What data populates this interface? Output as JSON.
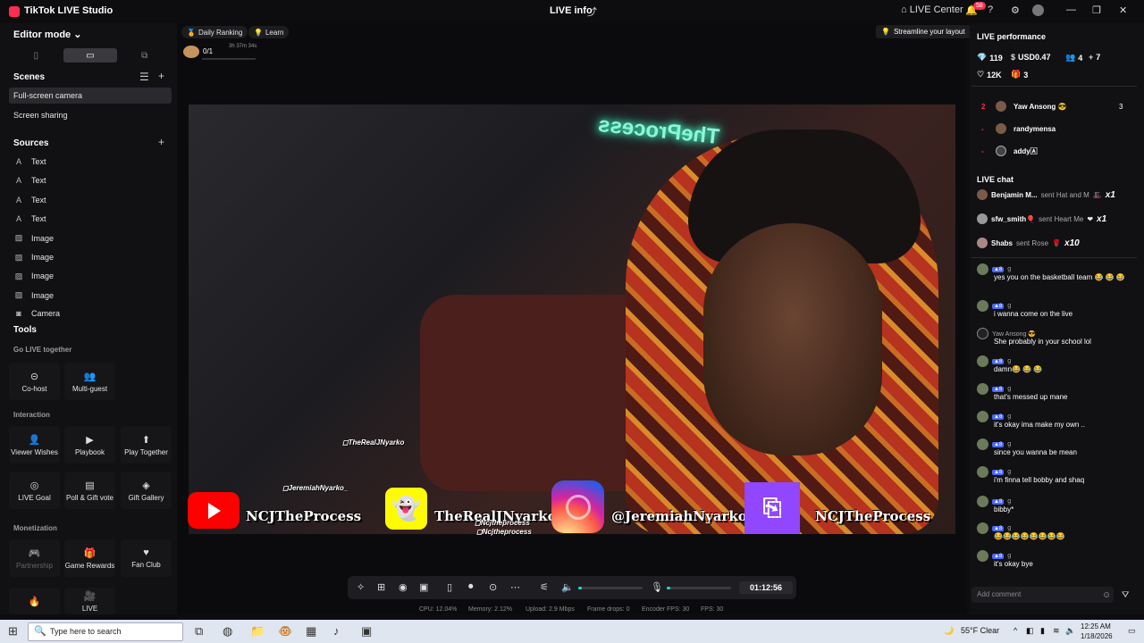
{
  "app": {
    "title": "TikTok LIVE Studio",
    "center_title": "LIVE info",
    "live_center": "LIVE Center",
    "notif_badge": "58"
  },
  "left": {
    "editor_mode": "Editor mode",
    "scenes_title": "Scenes",
    "scenes": [
      "Full-screen camera",
      "Screen sharing"
    ],
    "sources_title": "Sources",
    "sources": [
      {
        "label": "Text",
        "icon": "text-icon"
      },
      {
        "label": "Text",
        "icon": "text-icon"
      },
      {
        "label": "Text",
        "icon": "text-icon"
      },
      {
        "label": "Text",
        "icon": "text-icon"
      },
      {
        "label": "Image",
        "icon": "image-icon"
      },
      {
        "label": "Image",
        "icon": "image-icon"
      },
      {
        "label": "Image",
        "icon": "image-icon"
      },
      {
        "label": "Image",
        "icon": "image-icon"
      },
      {
        "label": "Camera",
        "icon": "camera-icon"
      }
    ],
    "tools_title": "Tools",
    "groups": {
      "live_together": "Go LIVE together",
      "interaction": "Interaction",
      "monetization": "Monetization"
    },
    "tools": {
      "cohost": "Co-host",
      "multiguest": "Multi-guest",
      "viewer_wishes": "Viewer Wishes",
      "playbook": "Playbook",
      "play_together": "Play Together",
      "live_goal": "LIVE Goal",
      "poll_gift_vote": "Poll & Gift vote",
      "gift_gallery": "Gift Gallery",
      "partnership": "Partnership",
      "game_rewards": "Game Rewards",
      "fan_club": "Fan Club",
      "live_partial": "LIVE"
    }
  },
  "canvas": {
    "daily_ranking": "Daily Ranking",
    "learn": "Learn",
    "rank_value": "0/1",
    "rank_time": "3h 37m 34s",
    "streamline": "Streamline your layout",
    "neon_text": "TheProcess",
    "overlay": {
      "tag_top": "TheRealJNyarko",
      "tag_ig": "JeremiahNyarko_",
      "youtube": "NCJTheProcess",
      "snapchat": "TheRealJNyarko",
      "instagram": "@JeremiahNyarko_",
      "twitch": "NCJTheProcess",
      "tag_nc1": "Ncjtheprocess",
      "tag_nc2": "Ncjtheprocess"
    },
    "timer": "01:12:56",
    "volume_level": 0.05,
    "mic_level": 0.05
  },
  "stats": {
    "cpu": "CPU: 12.04%",
    "memory": "Memory: 2.12%",
    "upload": "Upload: 2.9 Mbps",
    "frame_drops": "Frame drops: 0",
    "encoder_fps": "Encoder FPS: 30",
    "fps": "FPS: 30"
  },
  "right": {
    "perf_title": "LIVE performance",
    "diamonds": "119",
    "usd": "USD0.47",
    "viewers": "4",
    "followers": "7",
    "likes": "12K",
    "gifts": "3",
    "ranking": [
      {
        "rank": "2",
        "name": "Yaw Ansong 😎",
        "score": "3"
      },
      {
        "rank": "-",
        "name": "randymensa",
        "score": ""
      },
      {
        "rank": "-",
        "name": "addy🄰",
        "score": ""
      }
    ],
    "chat_title": "LIVE chat",
    "gifts_list": [
      {
        "name": "Benjamin M...",
        "action": "sent Hat and M",
        "count": "x1"
      },
      {
        "name": "sfw_smith🎈",
        "action": "sent Heart Me",
        "count": "x1"
      },
      {
        "name": "Shabs",
        "action": "sent Rose",
        "count": "x10"
      }
    ],
    "messages": [
      {
        "user": "g",
        "text": "yes you on the basketball team 😂 😂 😂"
      },
      {
        "user": "g",
        "text": "i wanna come on the live"
      },
      {
        "user": "Yaw Ansong 😎",
        "text": "She probably in your school lol"
      },
      {
        "user": "g",
        "text": "damn😂 😂 😂"
      },
      {
        "user": "g",
        "text": "that's messed up mane"
      },
      {
        "user": "g",
        "text": "it's okay ima make my own .."
      },
      {
        "user": "g",
        "text": "since you wanna be mean"
      },
      {
        "user": "g",
        "text": "i'm finna tell bobby and shaq"
      },
      {
        "user": "g",
        "text": "bibby*"
      },
      {
        "user": "g",
        "text": "😂😂😂😂😂😂😂😂"
      },
      {
        "user": "g",
        "text": "it's okay bye"
      }
    ],
    "comment_placeholder": "Add comment"
  },
  "taskbar": {
    "search_placeholder": "Type here to search",
    "weather": "55°F  Clear",
    "time": "12:25 AM",
    "date": "1/18/2026"
  }
}
